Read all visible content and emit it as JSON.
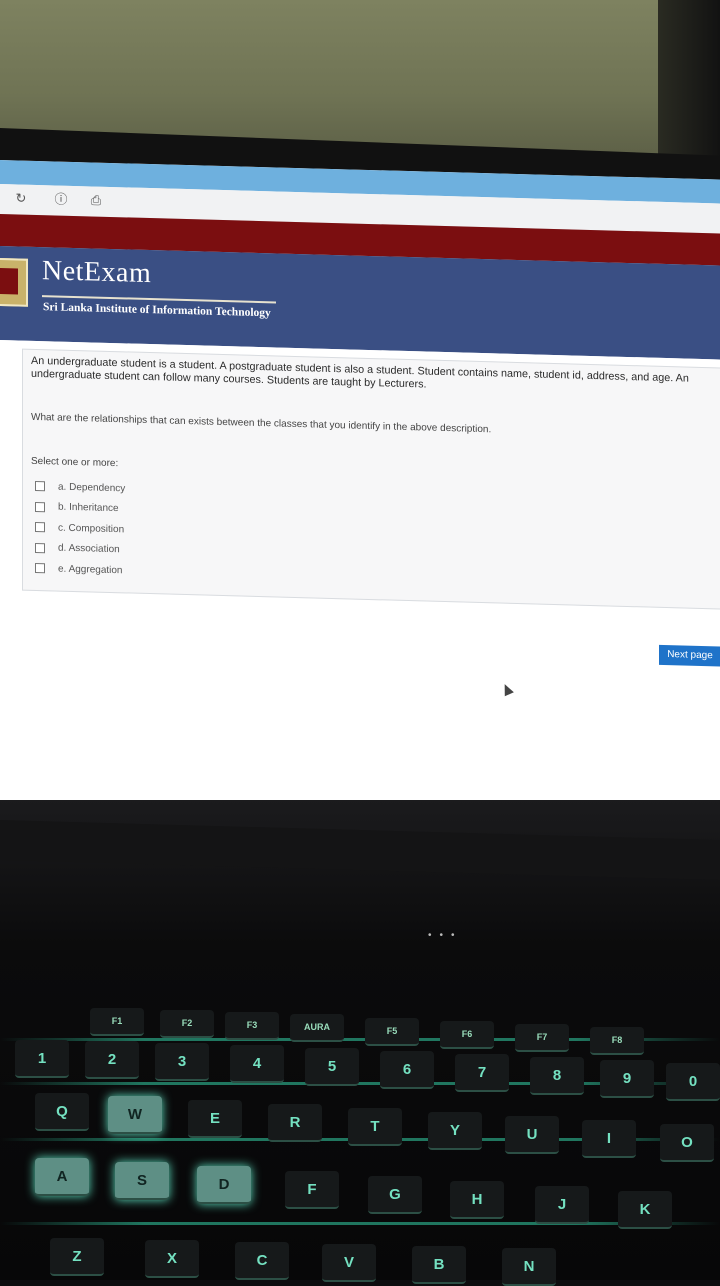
{
  "browser": {
    "tab_close": "×",
    "info_icon": "ⓘ",
    "page_icon": "⎙",
    "reload_icon": "↻"
  },
  "header": {
    "brand": "NetExam",
    "subtitle": "Sri Lanka Institute of Information Technology"
  },
  "question": {
    "text": "An undergraduate student is a student.  A postgraduate student is also a student. Student contains name, student id, address, and age. An undergraduate student can follow many courses. Students are taught by Lecturers.",
    "prompt": "What are the relationships that can exists between the classes that you identify in the above description.",
    "select_label": "Select one or more:",
    "options": [
      "a. Dependency",
      "b. Inheritance",
      "c. Composition",
      "d. Association",
      "e. Aggregation"
    ]
  },
  "actions": {
    "next_page": "Next page"
  },
  "keyboard": {
    "fn_keys": [
      "F1",
      "F2",
      "F3",
      "AURA",
      "F5",
      "F6",
      "F7",
      "F8"
    ],
    "num_row": [
      "1",
      "2",
      "3",
      "4",
      "5",
      "6",
      "7",
      "8",
      "9",
      "0"
    ],
    "top_row": [
      "Q",
      "W",
      "E",
      "R",
      "T",
      "Y",
      "U",
      "I",
      "O"
    ],
    "home_row": [
      "A",
      "S",
      "D",
      "F",
      "G",
      "H",
      "J",
      "K"
    ],
    "bottom_row": [
      "Z",
      "X",
      "C",
      "V",
      "B",
      "N"
    ]
  },
  "colors": {
    "banner": "#3a4f84",
    "red_bar": "#7b0e10",
    "next_button": "#1f73c9",
    "key_glow": "#5de0c0"
  }
}
